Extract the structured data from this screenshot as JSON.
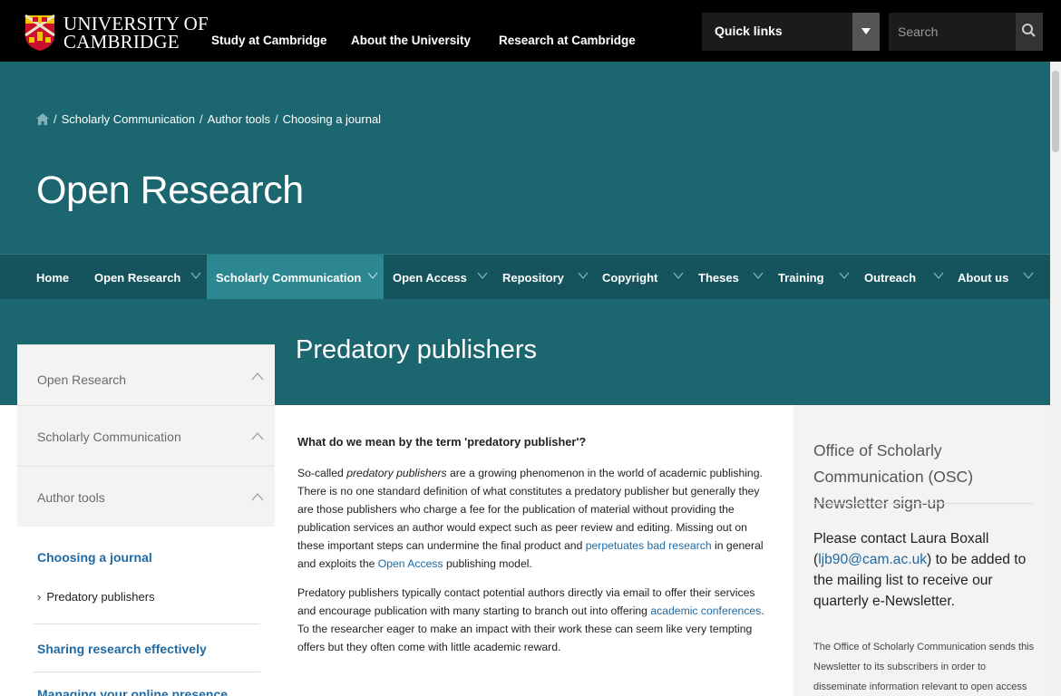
{
  "brand": {
    "line1": "UNIVERSITY OF",
    "line2": "CAMBRIDGE",
    "colors": {
      "topbar": "#000000",
      "teal": "#1c6670",
      "nav": "#15545c",
      "active_nav": "#2d8791",
      "link": "#1f6aa3"
    }
  },
  "topnav": {
    "items": [
      "Study at Cambridge",
      "About the University",
      "Research at Cambridge"
    ],
    "quick_links_label": "Quick links",
    "search_placeholder": "Search"
  },
  "breadcrumb": [
    "Scholarly Communication",
    "Author tools",
    "Choosing a journal"
  ],
  "site_title": "Open Research",
  "mainnav": {
    "items": [
      {
        "label": "Home",
        "has_dropdown": false
      },
      {
        "label": "Open Research",
        "has_dropdown": true
      },
      {
        "label": "Scholarly Communication",
        "has_dropdown": true,
        "active": true
      },
      {
        "label": "Open Access",
        "has_dropdown": true
      },
      {
        "label": "Repository",
        "has_dropdown": true
      },
      {
        "label": "Copyright",
        "has_dropdown": true
      },
      {
        "label": "Theses",
        "has_dropdown": true
      },
      {
        "label": "Training",
        "has_dropdown": true
      },
      {
        "label": "Outreach",
        "has_dropdown": true
      },
      {
        "label": "About us",
        "has_dropdown": true
      }
    ]
  },
  "page_title": "Predatory publishers",
  "sidenav": {
    "sections": [
      "Open Research",
      "Scholarly Communication",
      "Author tools"
    ],
    "current_parent": "Choosing a journal",
    "current": "Predatory publishers",
    "next_items": [
      "Sharing research effectively",
      "Managing your online presence"
    ]
  },
  "content": {
    "heading": "What do we mean by the term 'predatory publisher'?",
    "p1_a": "So-called ",
    "p1_em": "predatory publishers",
    "p1_b": " are a growing phenomenon in the world of academic publishing. There is no one standard definition of what constitutes a predatory publisher but generally they are those publishers who charge a fee for the publication of material without providing the publication services an author would expect such as peer review and editing. Missing out on these important steps can undermine the final product and ",
    "p1_link1": "perpetuates bad research",
    "p1_c": " in general and exploits the ",
    "p1_link2": "Open Access",
    "p1_d": " publishing model.",
    "p2_a": "Predatory publishers typically contact potential authors directly via email to offer their services and encourage publication with many starting to branch out into offering ",
    "p2_link": "academic conferences",
    "p2_b": ". To the researcher eager to make an impact with their work these can seem like very tempting offers but they often come with little academic reward."
  },
  "rightbox": {
    "title": "Office of Scholarly Communication (OSC) Newsletter sign-up",
    "contact_a": "Please contact Laura Boxall (",
    "contact_email": "ljb90@cam.ac.uk",
    "contact_b": ") to be added to the mailing list to receive our quarterly e-Newsletter.",
    "small": "The Office of Scholarly Communication sends this Newsletter to its subscribers in order to disseminate information relevant to open access"
  }
}
